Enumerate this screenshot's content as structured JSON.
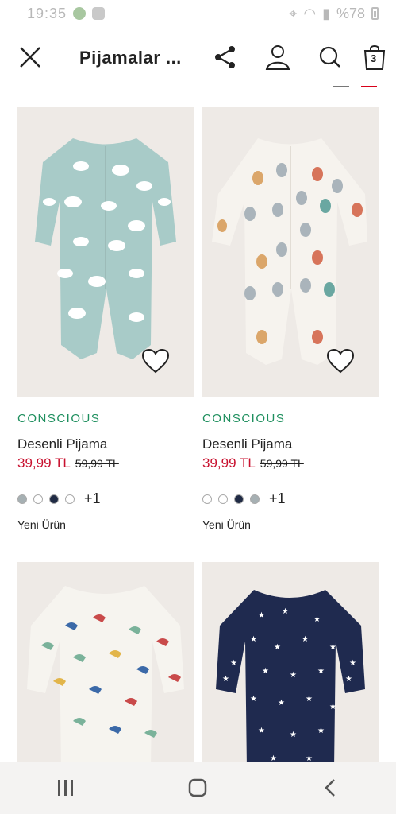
{
  "status_bar": {
    "time": "19:35",
    "battery": "%78"
  },
  "header": {
    "title": "Pijamalar ...",
    "cart_count": "3"
  },
  "products": [
    {
      "tag": "CONSCIOUS",
      "name": "Desenli Pijama",
      "price_new": "39,99 TL",
      "price_old": "59,99 TL",
      "swatches": [
        "#a6b0b3",
        "#ffffff",
        "#1f2a44",
        "#ffffff"
      ],
      "more": "+1",
      "badge": "Yeni Ürün",
      "colors": {
        "body": "#a8cbc8",
        "pattern": "#ffffff"
      }
    },
    {
      "tag": "CONSCIOUS",
      "name": "Desenli Pijama",
      "price_new": "39,99 TL",
      "price_old": "59,99 TL",
      "swatches": [
        "#ffffff",
        "#ffffff",
        "#1f2a44",
        "#a6b0b3"
      ],
      "more": "+1",
      "badge": "Yeni Ürün",
      "colors": {
        "body": "#f6f3ee",
        "pattern": "#d7745a"
      }
    },
    {
      "colors": {
        "body": "#f6f4ef",
        "pattern": "#7ab29a"
      }
    },
    {
      "colors": {
        "body": "#1f2a4f",
        "pattern": "#ffffff"
      }
    }
  ],
  "nav": {
    "icons": [
      "recents-icon",
      "home-icon",
      "back-icon"
    ]
  }
}
